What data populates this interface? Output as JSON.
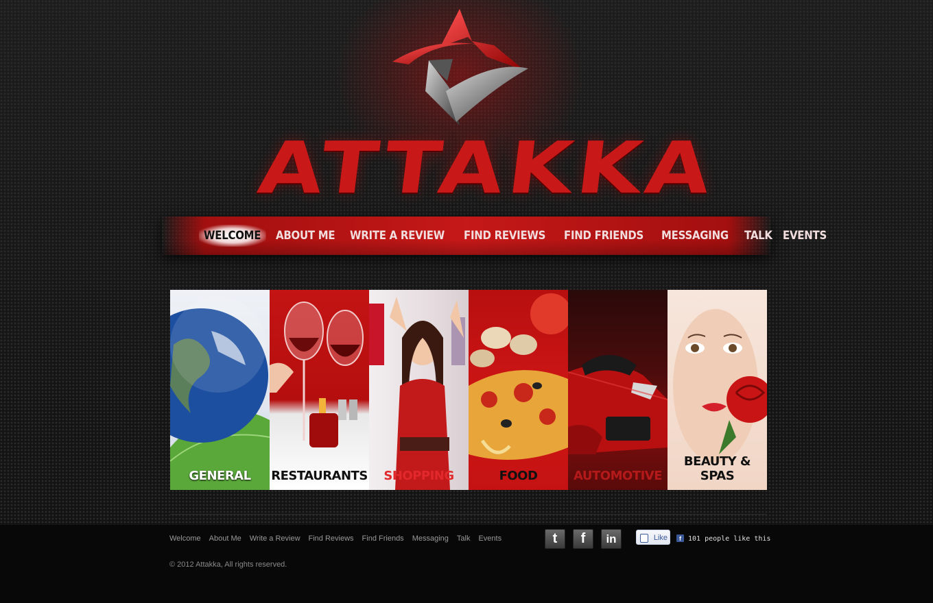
{
  "brand": {
    "name": "ATTAKKA"
  },
  "nav": {
    "items": [
      "Welcome",
      "About Me",
      "Write a Review",
      "Find Reviews",
      "Find Friends",
      "Messaging",
      "Talk",
      "Events"
    ],
    "active": "Welcome"
  },
  "categories": [
    {
      "label": "General",
      "label_color": "#ffffff",
      "icon": "globe-icon"
    },
    {
      "label": "Restaurants",
      "label_color": "#111111",
      "icon": "wine-glass-icon"
    },
    {
      "label": "Shopping",
      "label_color": "#e2282a",
      "icon": "shopping-bag-icon"
    },
    {
      "label": "Food",
      "label_color": "#111111",
      "icon": "pizza-icon"
    },
    {
      "label": "Automotive",
      "label_color": "#b51a1a",
      "icon": "car-icon"
    },
    {
      "label": "Beauty & Spas",
      "label_color": "#111111",
      "icon": "rose-icon"
    }
  ],
  "footer": {
    "links": [
      "Welcome",
      "About Me",
      "Write a Review",
      "Find Reviews",
      "Find Friends",
      "Messaging",
      "Talk",
      "Events"
    ],
    "copyright": "© 2012 Attakka, All rights reserved.",
    "social": [
      {
        "icon": "tumblr-icon",
        "glyph": "t"
      },
      {
        "icon": "facebook-icon",
        "glyph": "f"
      },
      {
        "icon": "linkedin-icon",
        "glyph": "in"
      }
    ],
    "like_label": "Like",
    "like_count_text": "101 people like this"
  },
  "colors": {
    "accent": "#c51818",
    "background": "#161616"
  }
}
